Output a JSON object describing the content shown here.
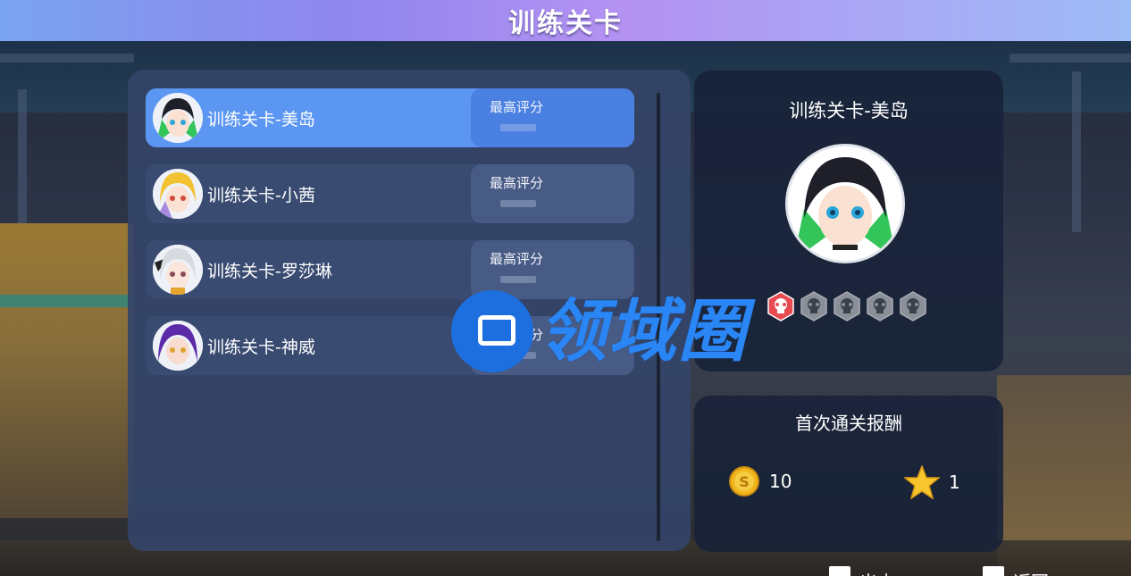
{
  "header": {
    "title": "训练关卡"
  },
  "levels": [
    {
      "name": "训练关卡-美岛",
      "score_label": "最高评分",
      "selected": true,
      "avatar": "meidao-avatar"
    },
    {
      "name": "训练关卡-小茜",
      "score_label": "最高评分",
      "selected": false,
      "avatar": "xiaoqian-avatar"
    },
    {
      "name": "训练关卡-罗莎琳",
      "score_label": "最高评分",
      "selected": false,
      "avatar": "luoshalin-avatar"
    },
    {
      "name": "训练关卡-神威",
      "score_label": "最高评分",
      "selected": false,
      "avatar": "shenwei-avatar"
    }
  ],
  "detail": {
    "title": "训练关卡-美岛",
    "difficulty": {
      "max": 5,
      "active": 1,
      "icon": "skull-icon"
    }
  },
  "rewards": {
    "title": "首次通关报酬",
    "items": [
      {
        "icon": "coin-icon",
        "amount": "10"
      },
      {
        "icon": "star-icon",
        "amount": "1"
      }
    ]
  },
  "watermark": {
    "text": "领域圈"
  },
  "buttons": {
    "start": "出击",
    "back": "返回"
  },
  "colors": {
    "selected": "#5b97f2",
    "panel": "#344468",
    "accent_red": "#e84a52",
    "coin": "#f2b61c",
    "star": "#f7c62e"
  }
}
